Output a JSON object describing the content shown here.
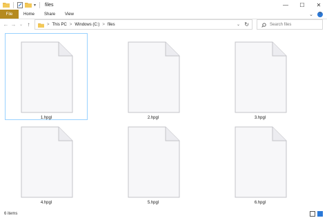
{
  "window": {
    "title": "files",
    "controls": {
      "minimize": "—",
      "maximize": "☐",
      "close": "✕"
    }
  },
  "ribbon": {
    "file_tab": "File",
    "tabs": [
      "Home",
      "Share",
      "View"
    ],
    "expand_glyph": "⌄",
    "help_glyph": "?"
  },
  "navigation": {
    "back": "←",
    "forward": "→",
    "recent": "⌄",
    "up": "↑"
  },
  "address": {
    "crumbs": [
      "This PC",
      "Windows (C:)",
      "files"
    ],
    "separator": ">",
    "dropdown": "⌄",
    "refresh": "↻"
  },
  "search": {
    "placeholder": "Search files"
  },
  "files": [
    {
      "name": "1.hpgl",
      "selected": true
    },
    {
      "name": "2.hpgl",
      "selected": false
    },
    {
      "name": "3.hpgl",
      "selected": false
    },
    {
      "name": "4.hpgl",
      "selected": false
    },
    {
      "name": "5.hpgl",
      "selected": false
    },
    {
      "name": "6.hpgl",
      "selected": false
    }
  ],
  "status": {
    "item_count": "6 items"
  },
  "icons": {
    "file": "blank-document-icon",
    "folder": "folder-icon",
    "search": "search-icon"
  },
  "colors": {
    "file_tab": "#b58a1f",
    "selection_border": "#99d1ff",
    "accent": "#2b79d8"
  }
}
